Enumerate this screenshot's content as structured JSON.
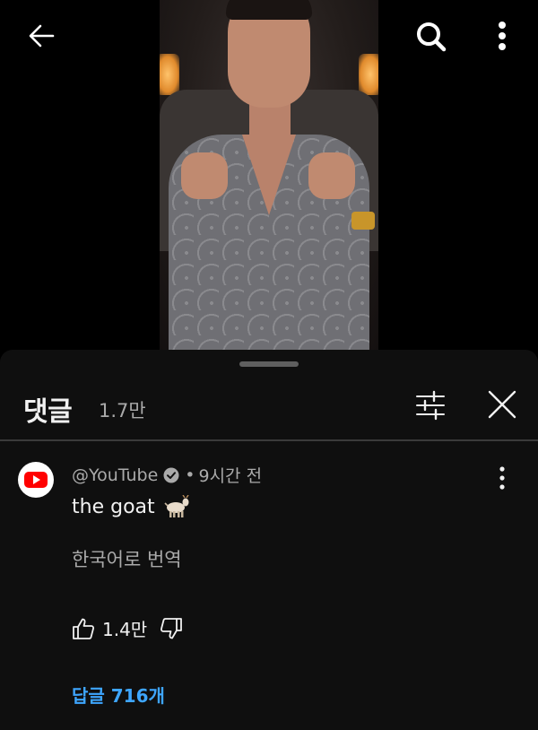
{
  "video": {
    "back_icon": "arrow-left-icon",
    "search_icon": "search-icon",
    "more_icon": "more-vertical-icon"
  },
  "comments_panel": {
    "title": "댓글",
    "count": "1.7만",
    "filter_icon": "sliders-icon",
    "close_icon": "close-icon"
  },
  "comment": {
    "author": "@YouTube",
    "verified_icon": "verified-check-icon",
    "separator": "•",
    "time": "9시간 전",
    "text": "the goat",
    "emoji_icon": "goat-icon",
    "translate_label": "한국어로 번역",
    "like_count": "1.4만",
    "replies_label": "답글 716개",
    "colors": {
      "link": "#3ea6ff",
      "avatar_brand": "#ff0000"
    }
  }
}
